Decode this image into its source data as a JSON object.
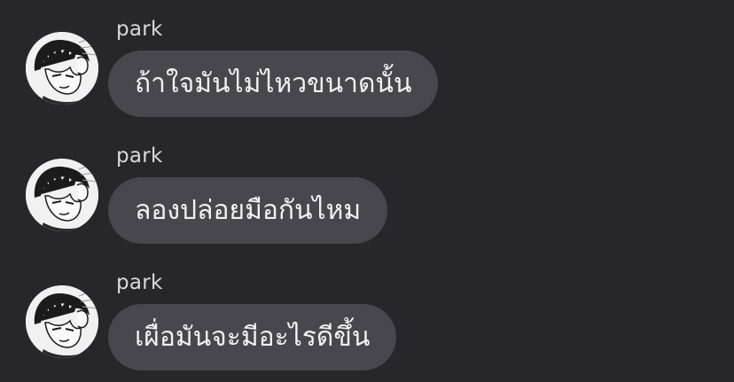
{
  "messages": [
    {
      "sender": "park",
      "text": "ถ้าใจมันไม่ไหวขนาดนั้น",
      "avatar_icon": "manga-character-avatar"
    },
    {
      "sender": "park",
      "text": "ลองปล่อยมือกันไหม",
      "avatar_icon": "manga-character-avatar"
    },
    {
      "sender": "park",
      "text": "เผื่อมันจะมีอะไรดีขึ้น",
      "avatar_icon": "manga-character-avatar"
    }
  ],
  "colors": {
    "background": "#26262b",
    "bubble": "#47474d",
    "text": "#f2f2f4",
    "sender": "#d9d9de"
  }
}
